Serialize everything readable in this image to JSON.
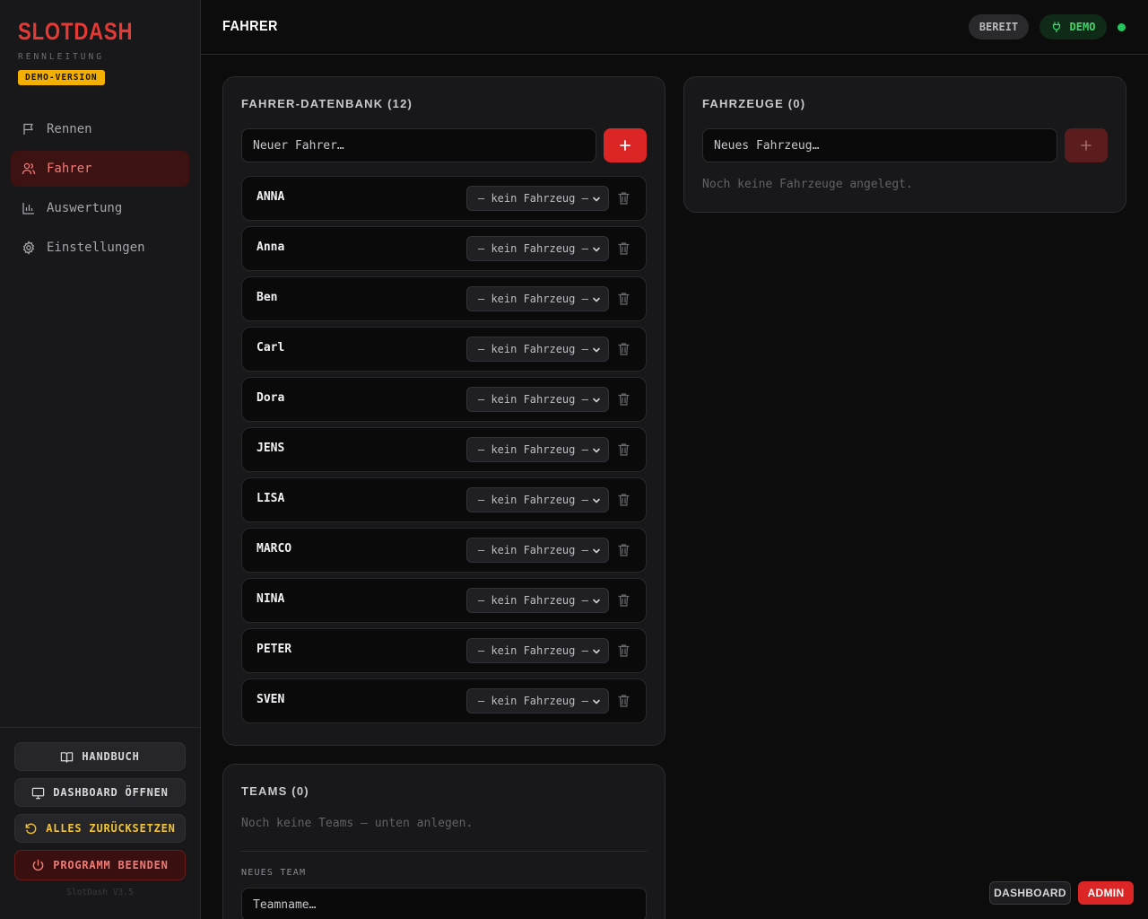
{
  "sidebar": {
    "brand": "SLOTDASH",
    "subtitle": "RENNLEITUNG",
    "badge": "DEMO-VERSION",
    "nav": [
      {
        "label": "Rennen",
        "icon": "flag-icon"
      },
      {
        "label": "Fahrer",
        "icon": "users-icon",
        "active": true
      },
      {
        "label": "Auswertung",
        "icon": "bar-chart-icon"
      },
      {
        "label": "Einstellungen",
        "icon": "gear-icon"
      }
    ],
    "buttons": {
      "manual": "HANDBUCH",
      "dashboard": "DASHBOARD ÖFFNEN",
      "reset": "ALLES ZURÜCKSETZEN",
      "quit": "PROGRAMM BEENDEN"
    },
    "version": "SlotDash V3.5"
  },
  "topbar": {
    "title": "FAHRER",
    "status": "BEREIT",
    "mode": "DEMO",
    "mode_icon": "plug-icon",
    "status_dot_color": "#22c55e"
  },
  "drivers_panel": {
    "title": "FAHRER-DATENBANK (12)",
    "input_placeholder": "Neuer Fahrer…",
    "rows": [
      {
        "name": "ANNA",
        "car": "— kein Fahrzeug —"
      },
      {
        "name": "Anna",
        "car": "— kein Fahrzeug —"
      },
      {
        "name": "Ben",
        "car": "— kein Fahrzeug —"
      },
      {
        "name": "Carl",
        "car": "— kein Fahrzeug —"
      },
      {
        "name": "Dora",
        "car": "— kein Fahrzeug —"
      },
      {
        "name": "JENS",
        "car": "— kein Fahrzeug —"
      },
      {
        "name": "LISA",
        "car": "— kein Fahrzeug —"
      },
      {
        "name": "MARCO",
        "car": "— kein Fahrzeug —"
      },
      {
        "name": "NINA",
        "car": "— kein Fahrzeug —"
      },
      {
        "name": "PETER",
        "car": "— kein Fahrzeug —"
      },
      {
        "name": "SVEN",
        "car": "— kein Fahrzeug —"
      }
    ]
  },
  "vehicles_panel": {
    "title": "FAHRZEUGE (0)",
    "input_placeholder": "Neues Fahrzeug…",
    "empty": "Noch keine Fahrzeuge angelegt."
  },
  "teams_panel": {
    "title": "TEAMS (0)",
    "empty": "Noch keine Teams — unten anlegen.",
    "new_label": "NEUES TEAM",
    "input_placeholder": "Teamname…"
  },
  "view_tabs": {
    "dashboard": "DASHBOARD",
    "admin": "ADMIN"
  },
  "colors": {
    "accent": "#dc2626",
    "badge": "#f4b000",
    "demo_green": "#3fd46a"
  }
}
